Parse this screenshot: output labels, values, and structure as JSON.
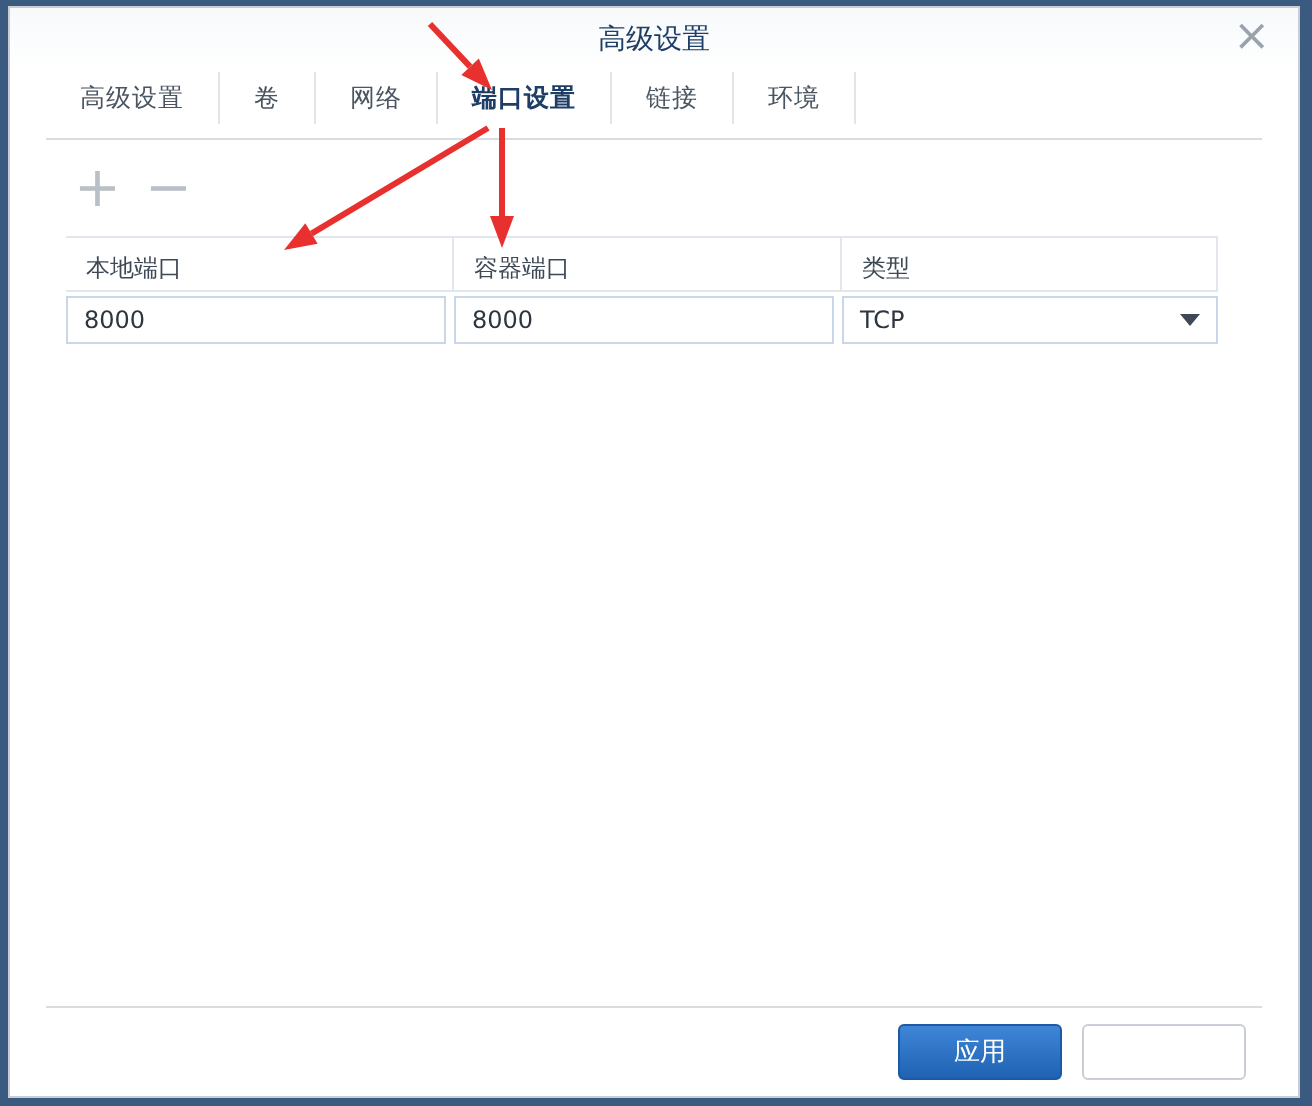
{
  "window": {
    "title": "高级设置",
    "close": "×"
  },
  "tabs": [
    {
      "label": "高级设置",
      "selected": false
    },
    {
      "label": "卷",
      "selected": false
    },
    {
      "label": "网络",
      "selected": false
    },
    {
      "label": "端口设置",
      "selected": true
    },
    {
      "label": "链接",
      "selected": false
    },
    {
      "label": "环境",
      "selected": false
    }
  ],
  "toolbar": {
    "add": "+",
    "remove": "−"
  },
  "table": {
    "columns": [
      "本地端口",
      "容器端口",
      "类型"
    ],
    "rows": [
      {
        "local_port": "8000",
        "container_port": "8000",
        "type": "TCP"
      }
    ]
  },
  "buttons": [
    {
      "label": "应用",
      "kind": "primary"
    },
    {
      "kind": "secondary"
    }
  ]
}
